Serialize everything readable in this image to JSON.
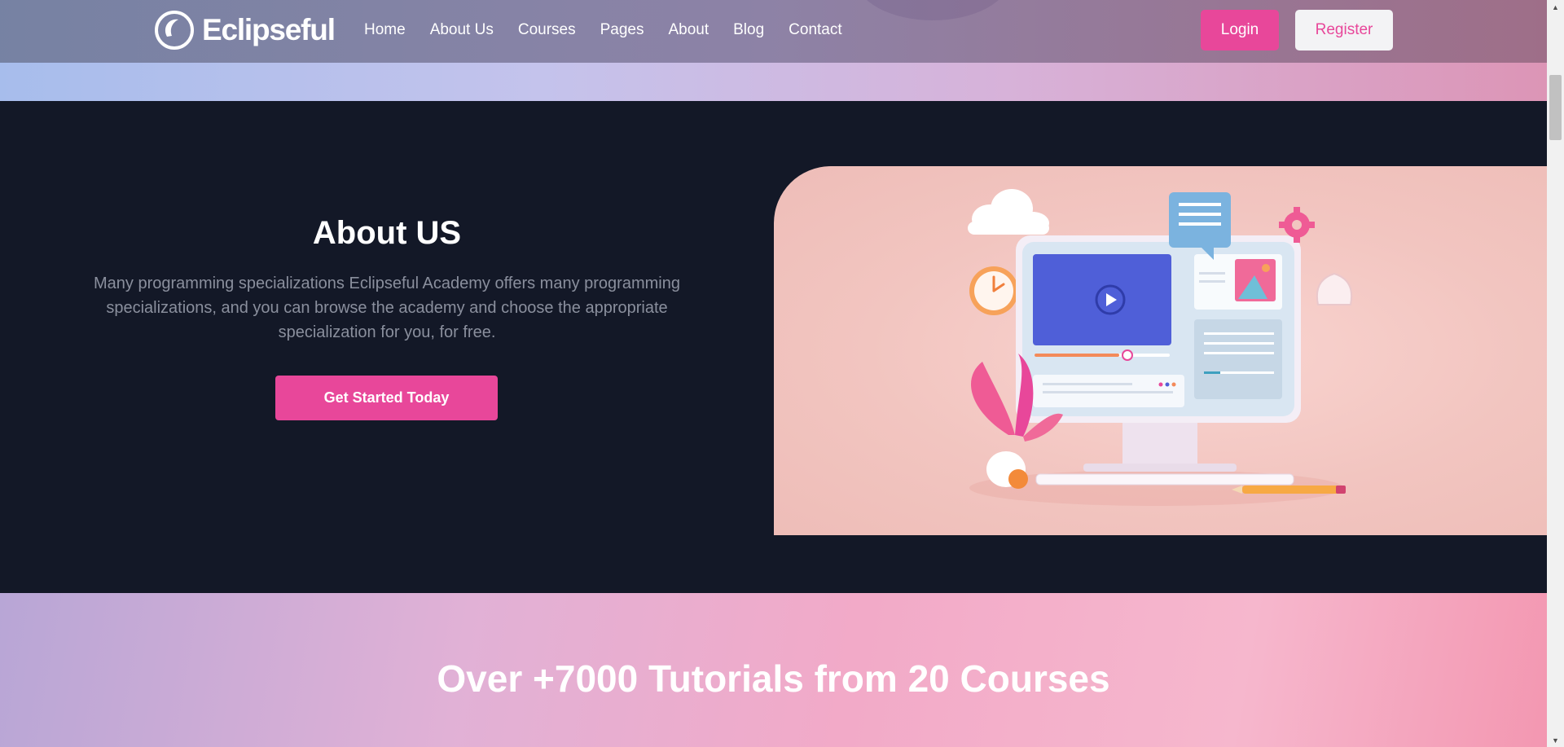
{
  "brand": {
    "name": "Eclipseful"
  },
  "nav": {
    "items": [
      {
        "label": "Home"
      },
      {
        "label": "About Us"
      },
      {
        "label": "Courses"
      },
      {
        "label": "Pages"
      },
      {
        "label": "About"
      },
      {
        "label": "Blog"
      },
      {
        "label": "Contact"
      }
    ],
    "login_label": "Login",
    "register_label": "Register"
  },
  "about": {
    "title": "About US",
    "description": "Many programming specializations Eclipseful Academy offers many programming specializations, and you can browse the academy and choose the appropriate specialization for you, for free.",
    "cta_label": "Get Started Today",
    "illustration_icon": "computer-learning-illustration"
  },
  "tutorials": {
    "title": "Over +7000 Tutorials from 20 Courses"
  },
  "colors": {
    "accent": "#e8479a",
    "dark_bg": "#131827",
    "muted_text": "#8a8f9d"
  }
}
